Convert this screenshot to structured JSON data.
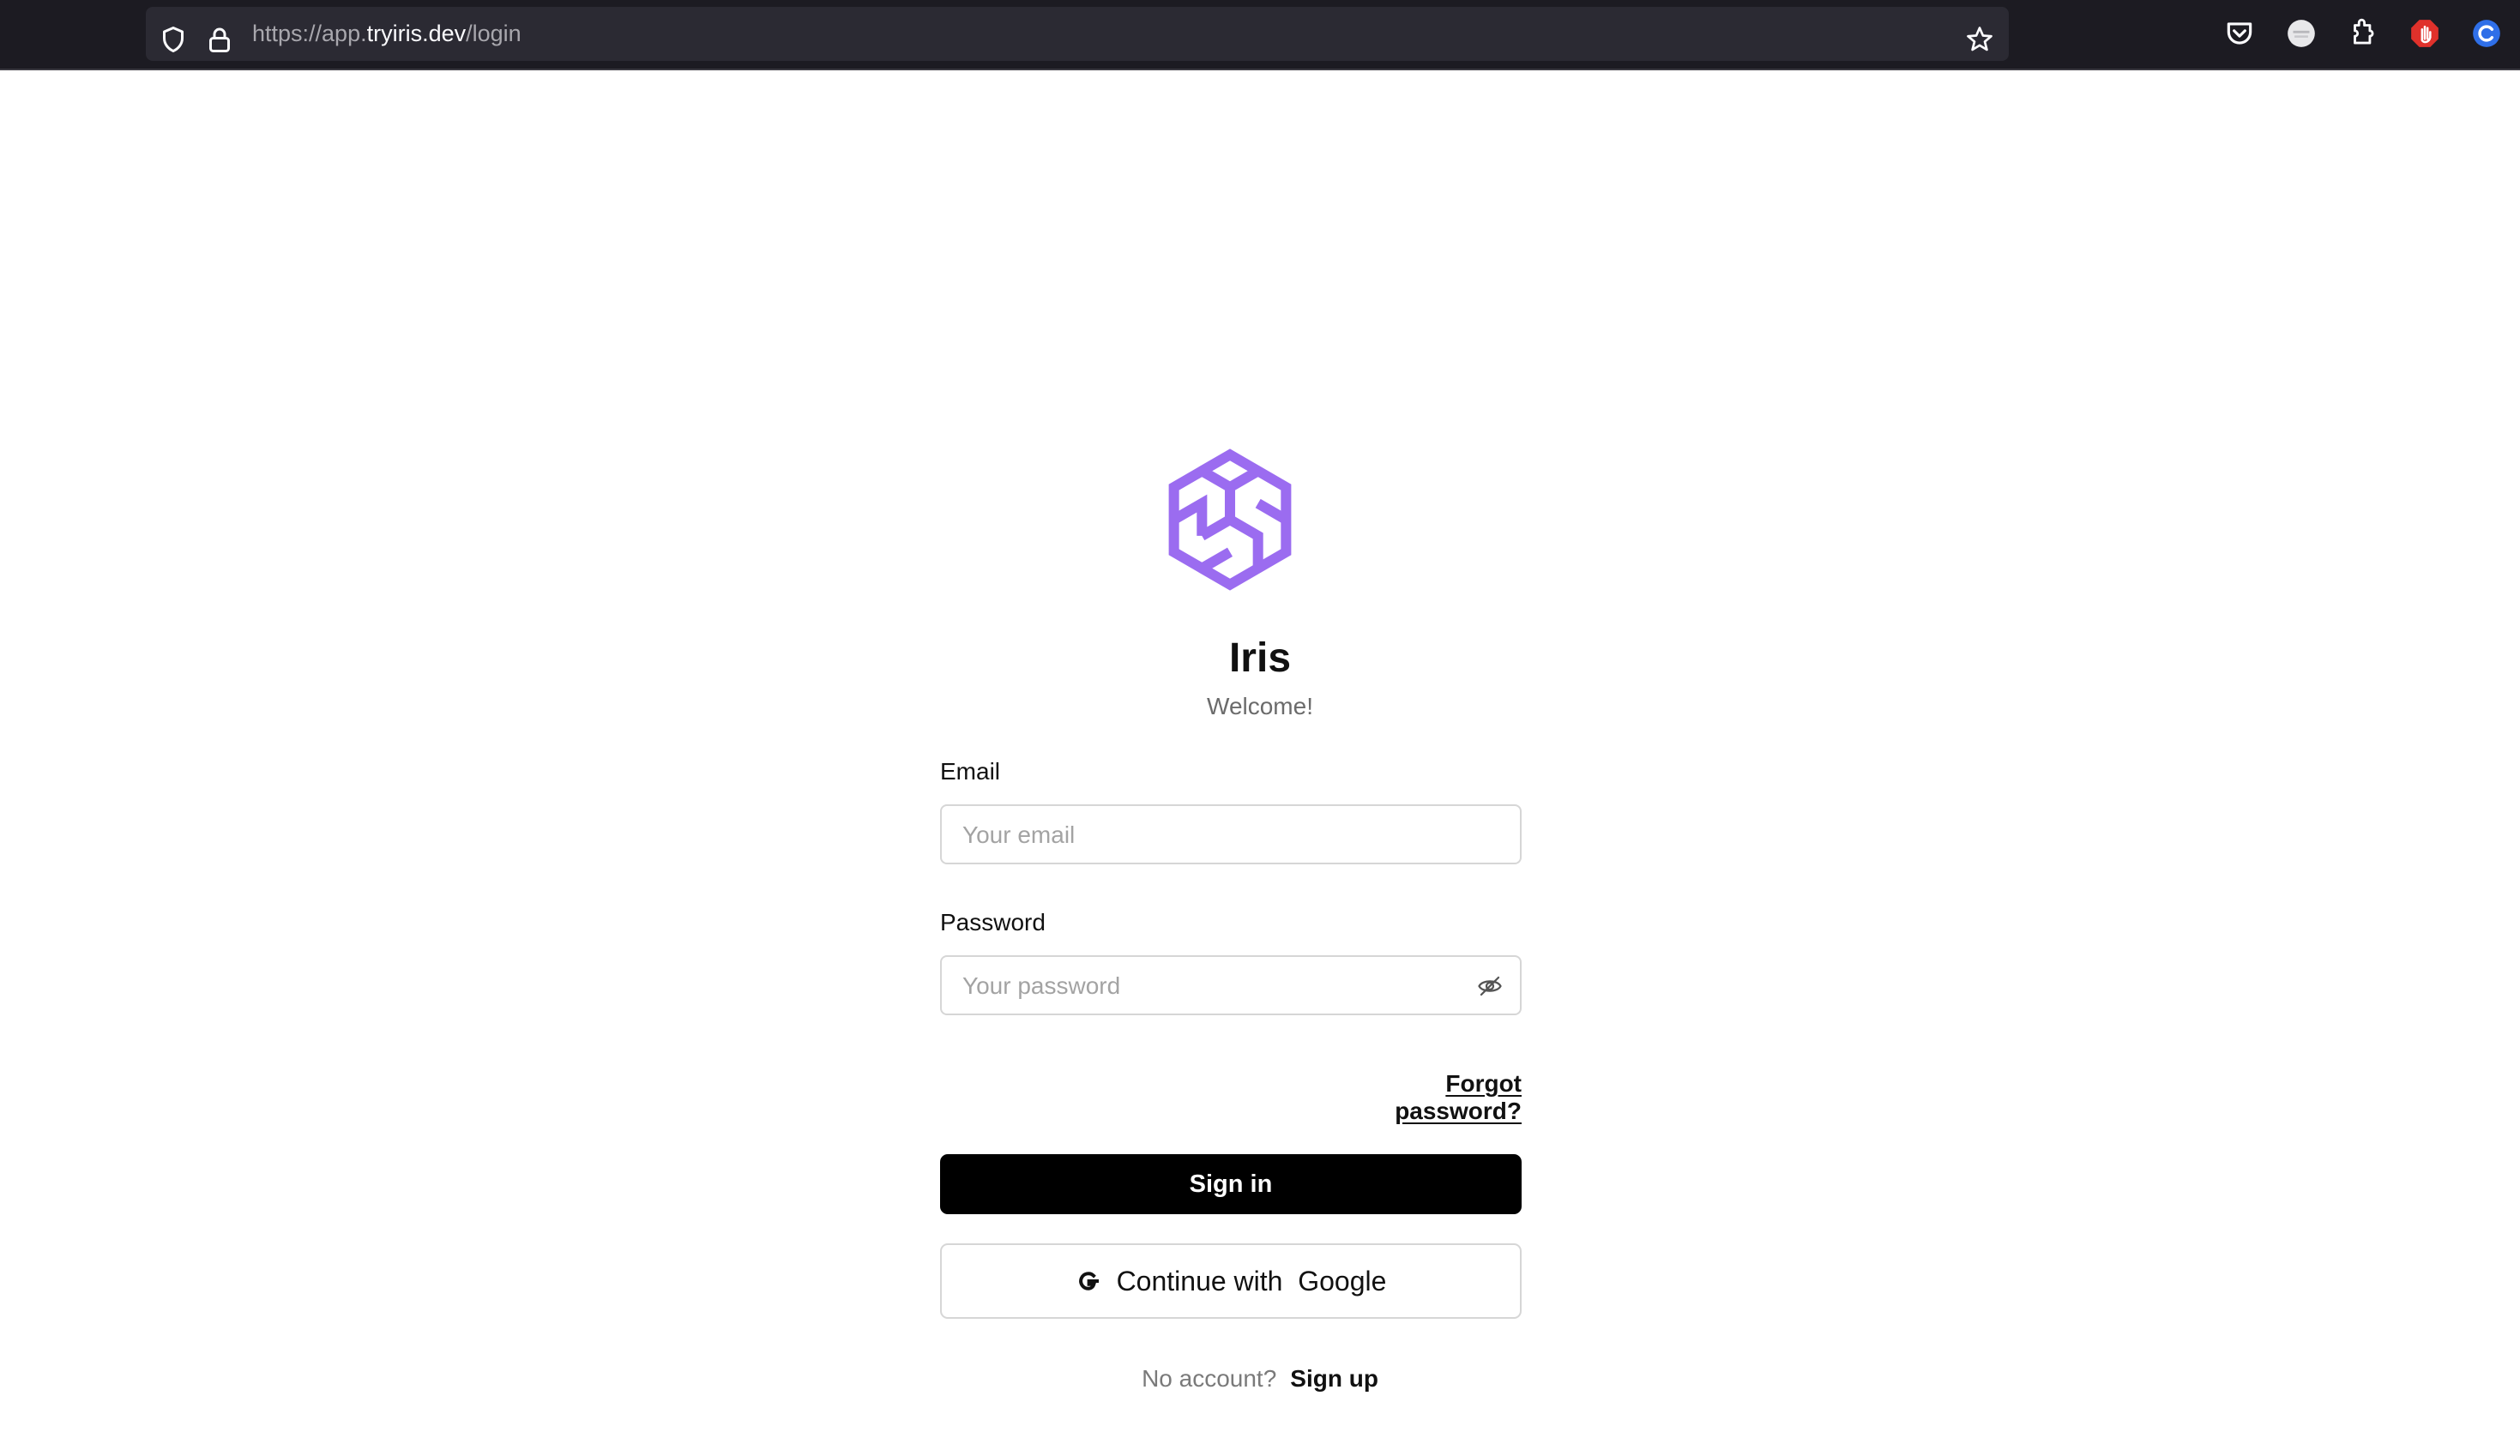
{
  "browser": {
    "url_prefix": "https://app.",
    "url_domain": "tryiris.dev",
    "url_path": "/login",
    "icons": [
      "shield-icon",
      "lock-icon",
      "star-icon",
      "pocket-icon",
      "account-icon",
      "extensions-icon",
      "adblock-icon",
      "extension-c-icon"
    ]
  },
  "app": {
    "name": "Iris",
    "welcome": "Welcome!",
    "brand_color": "#9b6cf0"
  },
  "form": {
    "email_label": "Email",
    "email_placeholder": "Your email",
    "password_label": "Password",
    "password_placeholder": "Your password",
    "forgot_label": "Forgot password?",
    "signin_label": "Sign in",
    "google_label": "Continue with  Google",
    "no_account": "No account?",
    "signup_label": "Sign up"
  }
}
